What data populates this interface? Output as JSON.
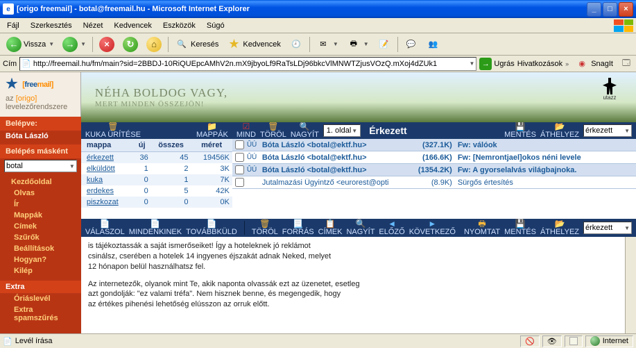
{
  "window": {
    "title": "[origo freemail] - botal@freemail.hu - Microsoft Internet Explorer",
    "min": "_",
    "max": "□",
    "close": "×"
  },
  "menu": [
    "Fájl",
    "Szerkesztés",
    "Nézet",
    "Kedvencek",
    "Eszközök",
    "Súgó"
  ],
  "toolbar": {
    "back": "Vissza",
    "search": "Keresés",
    "favorites": "Kedvencek"
  },
  "addr": {
    "label": "Cím",
    "url": "http://freemail.hu/fm/main?sid=2BBDJ-10RiQUEpcAMhV2n.mX9jbyoLf9RaTsLDj96bkcVlMNWTZjusVOzQ.mXoj4dZUk1",
    "go": "Ugrás",
    "links": "Hivatkozások",
    "snagit": "SnagIt"
  },
  "brand": {
    "free": "free",
    "mail": "mail",
    "bracket_open": "[",
    "bracket_close": "]",
    "tagline_pre": "az ",
    "tagline_origo": "[origo]",
    "tagline_post": " levelezőrendszere"
  },
  "banner": {
    "line1": "NÉHA BOLDOG VAGY,",
    "line2": "MERT MINDEN ÖSSZEJÖN!",
    "tag": "utazz"
  },
  "side": {
    "logged_label": "Belépve:",
    "user": "Bóta László",
    "alt_label": "Belépés másként",
    "alt_value": "botal",
    "items": [
      "Kezdőoldal",
      "Olvas",
      "Ír",
      "Mappák",
      "Címek",
      "Szűrők",
      "Beállítások",
      "Hogyan?",
      "Kilép"
    ],
    "extra": "Extra",
    "extra_items": [
      "Óriáslevél",
      "Extra spamszűrés"
    ]
  },
  "fptools": {
    "empty": "KUKA ÜRÍTÉSE",
    "folders": "MAPPÁK"
  },
  "folders": {
    "headers": [
      "mappa",
      "új",
      "összes",
      "méret"
    ],
    "rows": [
      {
        "name": "érkezett",
        "new": "36",
        "all": "45",
        "size": "19456K"
      },
      {
        "name": "elküldött",
        "new": "1",
        "all": "2",
        "size": "3K"
      },
      {
        "name": "kuka",
        "new": "0",
        "all": "1",
        "size": "7K"
      },
      {
        "name": "erdekes",
        "new": "0",
        "all": "5",
        "size": "42K"
      },
      {
        "name": "piszkozat",
        "new": "0",
        "all": "0",
        "size": "0K"
      }
    ]
  },
  "msgbar": {
    "all": "MIND",
    "del": "TÖRÖL",
    "zoom": "NAGYÍT",
    "page": "1. oldal",
    "title": "Érkezett",
    "save": "MENTÉS",
    "move": "ÁTHELYEZ",
    "sel": "érkezett"
  },
  "messages": [
    {
      "flags": "ÛÚ",
      "from": "Bóta László <botal@ektf.hu>",
      "size": "(327.1K)",
      "subj": "Fw: válóok"
    },
    {
      "flags": "ÛÚ",
      "from": "Bóta László <botal@ektf.hu>",
      "size": "(166.6K)",
      "subj": "Fw: [Nemrontjael]okos néni levele"
    },
    {
      "flags": "ÛÚ",
      "from": "Bóta László <botal@ektf.hu>",
      "size": "(1354.2K)",
      "subj": "Fw: A gyorselalvás világbajnoka."
    },
    {
      "flags": "",
      "from": "Jutalmazási Ügyintző <eurorest@opti",
      "size": "(8.9K)",
      "subj": "Sürgős értesítés"
    }
  ],
  "readbar": {
    "reply": "VÁLASZOL",
    "replyall": "MINDENKINEK",
    "fwd": "TOVÁBBKÜLD",
    "del": "TÖRÖL",
    "src": "FORRÁS",
    "addr": "CÍMEK",
    "zoom": "NAGYÍT",
    "prev": "ELŐZŐ",
    "next": "KÖVETKEZŐ",
    "print": "NYOMTAT",
    "save": "MENTÉS",
    "move": "ÁTHELYEZ",
    "sel": "érkezett"
  },
  "body": {
    "p1": "is tájékoztassák a saját ismerőseiket! Így a hoteleknek jó reklámot",
    "p2": "csinálsz, cserében a hotelek 14 ingyenes éjszakát adnak Neked, melyet",
    "p3": "12 hónapon belül használhatsz fel.",
    "p4": "Az internetezők, olyanok mint Te, akik naponta olvassák ezt az üzenetet, esetleg",
    "p5": "azt gondolják: \"ez valami tréfa\". Nem hisznek benne, és megengedik, hogy",
    "p6": "az értékes pihenési lehetőség elússzon az orruk előtt."
  },
  "status": {
    "text": "Levél írása",
    "zone": "Internet"
  }
}
